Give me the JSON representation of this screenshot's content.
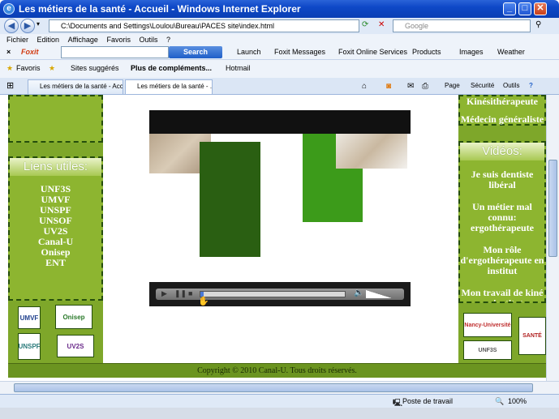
{
  "window": {
    "title": "Les métiers de la santé - Accueil - Windows Internet Explorer",
    "buttons": {
      "minimize": "_",
      "maximize": "□",
      "close": "✕"
    }
  },
  "address": {
    "url": "C:\\Documents and Settings\\Loulou\\Bureau\\PACES site\\index.html",
    "search_placeholder": "Google"
  },
  "menu": [
    "Fichier",
    "Edition",
    "Affichage",
    "Favoris",
    "Outils",
    "?"
  ],
  "foxit": {
    "brand": "Foxit",
    "search_button": "Search",
    "items": [
      "Launch",
      "Foxit Messages",
      "Foxit Online Services",
      "Products",
      "Images",
      "Weather"
    ]
  },
  "favorites": {
    "label": "Favoris",
    "items": [
      "Sites suggérés",
      "Plus de compléments...",
      "Hotmail"
    ]
  },
  "tabs": [
    {
      "label": "Les métiers de la santé - Acc..."
    },
    {
      "label": "Les métiers de la santé - ..."
    }
  ],
  "commandbar": [
    "Page",
    "Sécurité",
    "Outils"
  ],
  "page": {
    "left": {
      "header": "Liens utiles:",
      "links": [
        "UNF3S",
        "UMVF",
        "UNSPF",
        "UNSOF",
        "UV2S",
        "Canal-U",
        "Onisep",
        "ENT"
      ],
      "logos": [
        "UMVF",
        "Onisep",
        "UNSPF",
        "UV2S"
      ]
    },
    "right": {
      "top_links": [
        "Kinésithérapeute",
        "Médecin généraliste"
      ],
      "header": "Vidéos:",
      "videos": [
        "Je suis dentiste libéral",
        "Un métier mal connu: ergothérapeute",
        "Mon rôle d'ergothérapeute en institut",
        "Mon travail de kiné en institut"
      ],
      "logos": [
        "Nancy-Université",
        "SANTÉ",
        "UNF3S"
      ]
    },
    "footer": "Copyright © 2010 Canal-U. Tous droits réservés."
  },
  "player": {
    "progress": 0.02,
    "volume": 0.8
  },
  "status": {
    "zone": "Poste de travail",
    "zoom": "100%"
  },
  "colors": {
    "accent_green": "#7ea72a",
    "dark_green": "#2a5f12",
    "bright_green": "#3c9b1a"
  }
}
